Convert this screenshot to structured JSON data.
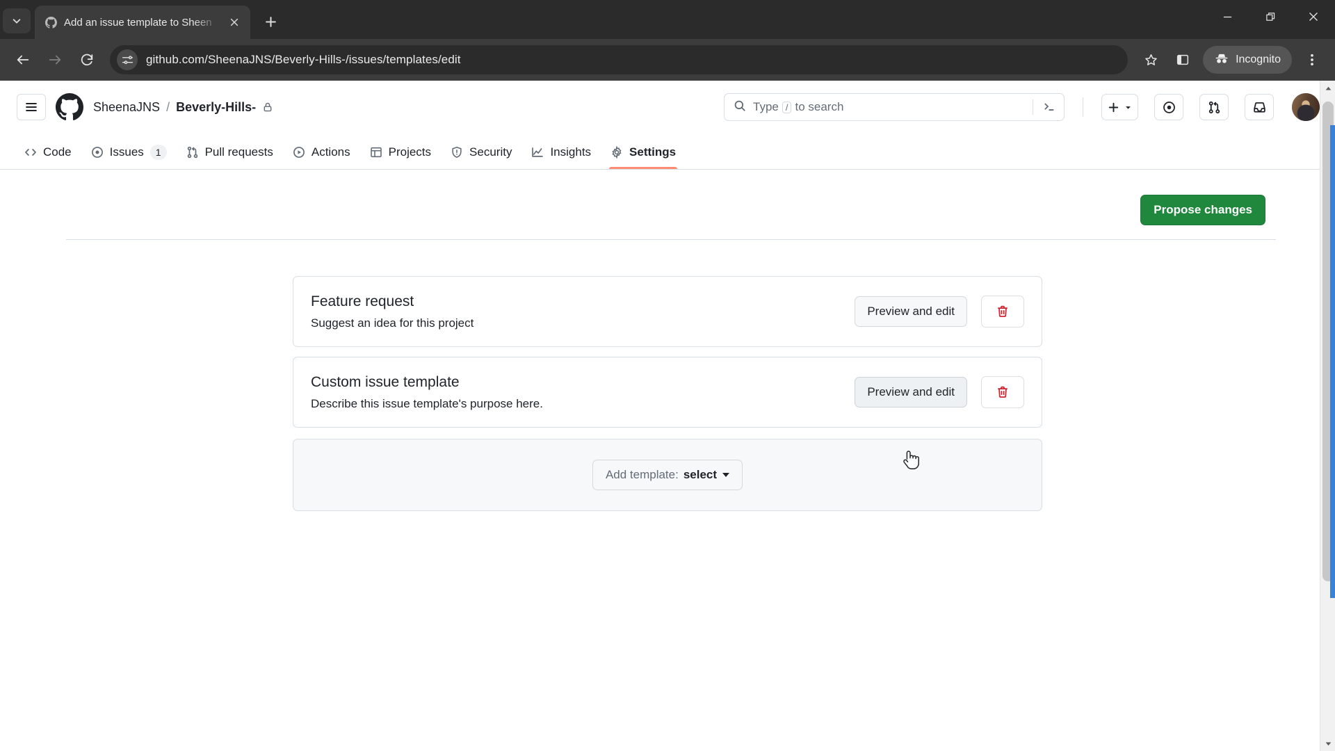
{
  "browser": {
    "tab": {
      "title": "Add an issue template to Sheen",
      "favicon_icon": "github-favicon",
      "close_icon": "close-icon"
    },
    "tab_search_icon": "chevron-down-icon",
    "new_tab_icon": "plus-icon",
    "window_controls": {
      "minimize_icon": "minimize-icon",
      "maximize_icon": "restore-icon",
      "close_icon": "close-icon"
    },
    "toolbar": {
      "back_icon": "arrow-left-icon",
      "forward_icon": "arrow-right-icon",
      "reload_icon": "reload-icon",
      "site_info_icon": "site-settings-icon",
      "url": "github.com/SheenaJNS/Beverly-Hills-/issues/templates/edit",
      "bookmark_icon": "star-icon",
      "side_panel_icon": "side-panel-icon",
      "incognito_label": "Incognito",
      "incognito_icon": "incognito-icon",
      "menu_icon": "kebab-menu-icon"
    }
  },
  "github": {
    "header": {
      "hamburger_icon": "hamburger-icon",
      "logo_icon": "github-logo-icon",
      "owner": "SheenaJNS",
      "separator": "/",
      "repo": "Beverly-Hills-",
      "visibility_icon": "lock-icon",
      "search": {
        "icon": "search-icon",
        "placeholder_prefix": "Type",
        "placeholder_key": "/",
        "placeholder_suffix": "to search",
        "command_palette_icon": "terminal-icon"
      },
      "actions": [
        {
          "name": "create-new-button",
          "icon": "plus-icon",
          "caret": "chevron-down-icon"
        },
        {
          "name": "issues-button",
          "icon": "issue-opened-icon"
        },
        {
          "name": "pull-requests-button",
          "icon": "git-pull-request-icon"
        },
        {
          "name": "notifications-button",
          "icon": "inbox-icon"
        }
      ],
      "avatar_alt": "user-avatar"
    },
    "nav": [
      {
        "label": "Code",
        "icon": "code-icon",
        "count": null,
        "active": false
      },
      {
        "label": "Issues",
        "icon": "issue-opened-icon",
        "count": "1",
        "active": false
      },
      {
        "label": "Pull requests",
        "icon": "git-pull-request-icon",
        "count": null,
        "active": false
      },
      {
        "label": "Actions",
        "icon": "play-icon",
        "count": null,
        "active": false
      },
      {
        "label": "Projects",
        "icon": "table-icon",
        "count": null,
        "active": false
      },
      {
        "label": "Security",
        "icon": "shield-icon",
        "count": null,
        "active": false
      },
      {
        "label": "Insights",
        "icon": "graph-icon",
        "count": null,
        "active": false
      },
      {
        "label": "Settings",
        "icon": "gear-icon",
        "count": null,
        "active": true
      }
    ],
    "main": {
      "propose_changes_label": "Propose changes",
      "templates": [
        {
          "title": "Feature request",
          "description": "Suggest an idea for this project",
          "preview_label": "Preview and edit",
          "delete_icon": "trash-icon",
          "hovered": false
        },
        {
          "title": "Custom issue template",
          "description": "Describe this issue template's purpose here.",
          "preview_label": "Preview and edit",
          "delete_icon": "trash-icon",
          "hovered": true
        }
      ],
      "add_template": {
        "prefix": "Add template:",
        "value": "select",
        "caret_icon": "caret-down-icon"
      }
    },
    "colors": {
      "accent_green": "#1f883d",
      "danger_red": "#cf222e",
      "active_tab_underline": "#fd8c73",
      "border": "#d8dee4",
      "canvas_subtle": "#f6f8fa"
    }
  },
  "scrollbar": {
    "up_arrow_icon": "triangle-up-icon",
    "down_arrow_icon": "triangle-down-icon",
    "thumb_name": "scrollbar-thumb"
  },
  "cursor": {
    "type": "pointer-hand-cursor"
  }
}
